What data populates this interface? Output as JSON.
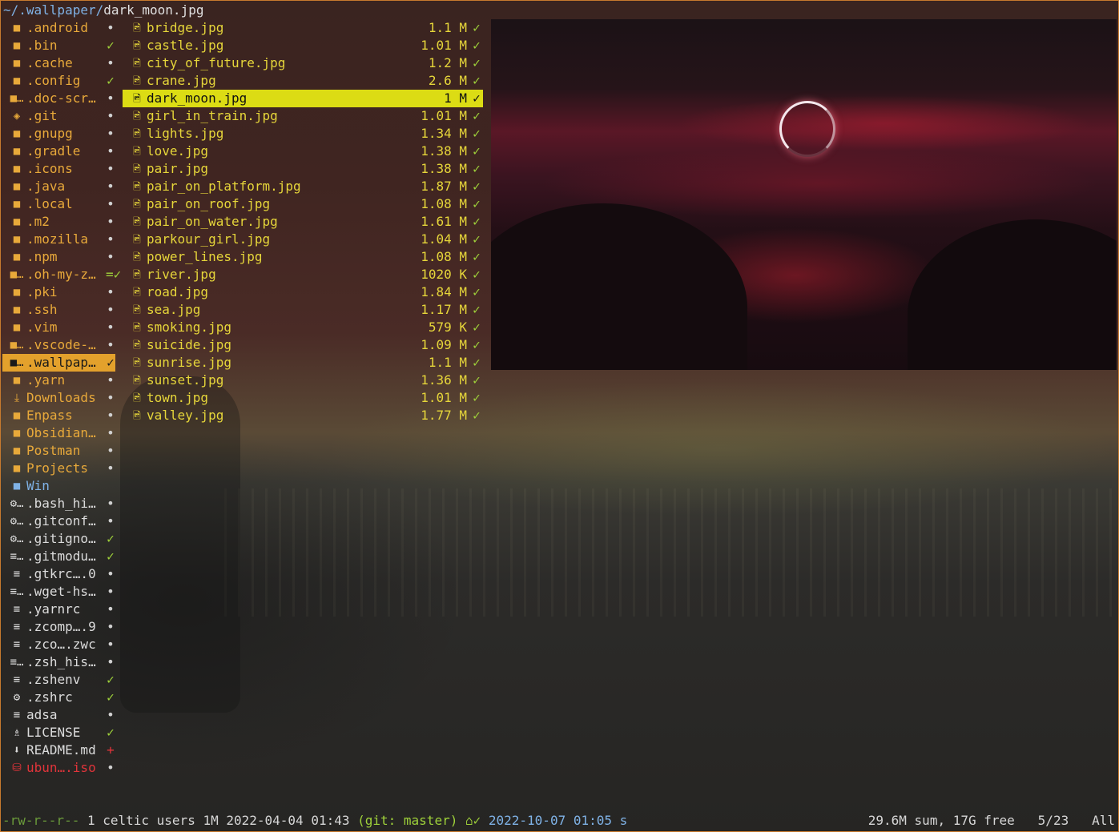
{
  "header": {
    "dir": "~/.wallpaper/",
    "file": "dark_moon.jpg"
  },
  "parent": [
    {
      "icon": "folder-icon",
      "glyph": "■",
      "name": ".android",
      "git": "•",
      "cls": "dirc"
    },
    {
      "icon": "folder-icon",
      "glyph": "■",
      "name": ".bin",
      "git": "✓",
      "cls": "dirc"
    },
    {
      "icon": "folder-icon",
      "glyph": "■",
      "name": ".cache",
      "git": "•",
      "cls": "dirc"
    },
    {
      "icon": "folder-icon",
      "glyph": "■",
      "name": ".config",
      "git": "✓",
      "cls": "dirc"
    },
    {
      "icon": "folder-icon",
      "glyph": "■…",
      "name": ".doc-scr…",
      "git": "•",
      "cls": "dirc"
    },
    {
      "icon": "git-icon",
      "glyph": "◈",
      "name": ".git",
      "git": "•",
      "cls": "dirc"
    },
    {
      "icon": "folder-icon",
      "glyph": "■",
      "name": ".gnupg",
      "git": "•",
      "cls": "dirc"
    },
    {
      "icon": "folder-icon",
      "glyph": "■",
      "name": ".gradle",
      "git": "•",
      "cls": "dirc"
    },
    {
      "icon": "folder-icon",
      "glyph": "■",
      "name": ".icons",
      "git": "•",
      "cls": "dirc"
    },
    {
      "icon": "folder-icon",
      "glyph": "■",
      "name": ".java",
      "git": "•",
      "cls": "dirc"
    },
    {
      "icon": "folder-icon",
      "glyph": "■",
      "name": ".local",
      "git": "•",
      "cls": "dirc"
    },
    {
      "icon": "folder-icon",
      "glyph": "■",
      "name": ".m2",
      "git": "•",
      "cls": "dirc"
    },
    {
      "icon": "folder-icon",
      "glyph": "■",
      "name": ".mozilla",
      "git": "•",
      "cls": "dirc"
    },
    {
      "icon": "folder-icon",
      "glyph": "■",
      "name": ".npm",
      "git": "•",
      "cls": "dirc"
    },
    {
      "icon": "folder-icon",
      "glyph": "■…",
      "name": ".oh-my-z…",
      "git": "=✓",
      "cls": "dirc"
    },
    {
      "icon": "folder-icon",
      "glyph": "■",
      "name": ".pki",
      "git": "•",
      "cls": "dirc"
    },
    {
      "icon": "folder-icon",
      "glyph": "■",
      "name": ".ssh",
      "git": "•",
      "cls": "dirc"
    },
    {
      "icon": "folder-icon",
      "glyph": "■",
      "name": ".vim",
      "git": "•",
      "cls": "dirc"
    },
    {
      "icon": "folder-icon",
      "glyph": "■…",
      "name": ".vscode-…",
      "git": "•",
      "cls": "dirc"
    },
    {
      "icon": "folder-icon",
      "glyph": "■…",
      "name": ".wallpap…",
      "git": "✓",
      "cls": "dirc",
      "selected": true
    },
    {
      "icon": "folder-icon",
      "glyph": "■",
      "name": ".yarn",
      "git": "•",
      "cls": "dirc"
    },
    {
      "icon": "downloads-icon",
      "glyph": "⤓",
      "name": "Downloads",
      "git": "•",
      "cls": "dirc"
    },
    {
      "icon": "folder-icon",
      "glyph": "■",
      "name": "Enpass",
      "git": "•",
      "cls": "dirc"
    },
    {
      "icon": "folder-icon",
      "glyph": "■",
      "name": "Obsidian…",
      "git": "•",
      "cls": "dirc"
    },
    {
      "icon": "folder-icon",
      "glyph": "■",
      "name": "Postman",
      "git": "•",
      "cls": "dirc"
    },
    {
      "icon": "folder-icon",
      "glyph": "■",
      "name": "Projects",
      "git": "•",
      "cls": "dirc"
    },
    {
      "icon": "folder-icon",
      "glyph": "■",
      "name": "Win",
      "git": "",
      "cls": "winc"
    },
    {
      "icon": "config-file-icon",
      "glyph": "⚙…",
      "name": ".bash_hi…",
      "git": "•",
      "cls": "filec"
    },
    {
      "icon": "config-file-icon",
      "glyph": "⚙…",
      "name": ".gitconf…",
      "git": "•",
      "cls": "filec"
    },
    {
      "icon": "config-file-icon",
      "glyph": "⚙…",
      "name": ".gitigno…",
      "git": "✓",
      "cls": "filec"
    },
    {
      "icon": "text-file-icon",
      "glyph": "≡…",
      "name": ".gitmodu…",
      "git": "✓",
      "cls": "filec"
    },
    {
      "icon": "text-file-icon",
      "glyph": "≡",
      "name": ".gtkrc….0",
      "git": "•",
      "cls": "filec"
    },
    {
      "icon": "text-file-icon",
      "glyph": "≡…",
      "name": ".wget-hs…",
      "git": "•",
      "cls": "filec"
    },
    {
      "icon": "text-file-icon",
      "glyph": "≡",
      "name": ".yarnrc",
      "git": "•",
      "cls": "filec"
    },
    {
      "icon": "text-file-icon",
      "glyph": "≡",
      "name": ".zcomp….9",
      "git": "•",
      "cls": "filec"
    },
    {
      "icon": "text-file-icon",
      "glyph": "≡",
      "name": ".zco….zwc",
      "git": "•",
      "cls": "filec"
    },
    {
      "icon": "text-file-icon",
      "glyph": "≡…",
      "name": ".zsh_his…",
      "git": "•",
      "cls": "filec"
    },
    {
      "icon": "text-file-icon",
      "glyph": "≡",
      "name": ".zshenv",
      "git": "✓",
      "cls": "filec"
    },
    {
      "icon": "gear-icon",
      "glyph": "⚙",
      "name": ".zshrc",
      "git": "✓",
      "cls": "filec"
    },
    {
      "icon": "text-file-icon",
      "glyph": "≡",
      "name": "adsa",
      "git": "•",
      "cls": "filec"
    },
    {
      "icon": "license-icon",
      "glyph": "♗",
      "name": "LICENSE",
      "git": "✓",
      "cls": "filec"
    },
    {
      "icon": "markdown-icon",
      "glyph": "⬇",
      "name": "README.md",
      "git": "+",
      "cls": "filec"
    },
    {
      "icon": "disk-image-icon",
      "glyph": "⛁",
      "name": "ubun….iso",
      "git": "•",
      "cls": "redc"
    }
  ],
  "files": [
    {
      "name": "bridge.jpg",
      "size": "1.1 M",
      "git": "✓"
    },
    {
      "name": "castle.jpg",
      "size": "1.01 M",
      "git": "✓"
    },
    {
      "name": "city_of_future.jpg",
      "size": "1.2 M",
      "git": "✓"
    },
    {
      "name": "crane.jpg",
      "size": "2.6 M",
      "git": "✓"
    },
    {
      "name": "dark_moon.jpg",
      "size": "1 M",
      "git": "✓",
      "selected": true
    },
    {
      "name": "girl_in_train.jpg",
      "size": "1.01 M",
      "git": "✓"
    },
    {
      "name": "lights.jpg",
      "size": "1.34 M",
      "git": "✓"
    },
    {
      "name": "love.jpg",
      "size": "1.38 M",
      "git": "✓"
    },
    {
      "name": "pair.jpg",
      "size": "1.38 M",
      "git": "✓"
    },
    {
      "name": "pair_on_platform.jpg",
      "size": "1.87 M",
      "git": "✓"
    },
    {
      "name": "pair_on_roof.jpg",
      "size": "1.08 M",
      "git": "✓"
    },
    {
      "name": "pair_on_water.jpg",
      "size": "1.61 M",
      "git": "✓"
    },
    {
      "name": "parkour_girl.jpg",
      "size": "1.04 M",
      "git": "✓"
    },
    {
      "name": "power_lines.jpg",
      "size": "1.08 M",
      "git": "✓"
    },
    {
      "name": "river.jpg",
      "size": "1020 K",
      "git": "✓"
    },
    {
      "name": "road.jpg",
      "size": "1.84 M",
      "git": "✓"
    },
    {
      "name": "sea.jpg",
      "size": "1.17 M",
      "git": "✓"
    },
    {
      "name": "smoking.jpg",
      "size": "579 K",
      "git": "✓"
    },
    {
      "name": "suicide.jpg",
      "size": "1.09 M",
      "git": "✓"
    },
    {
      "name": "sunrise.jpg",
      "size": "1.1 M",
      "git": "✓"
    },
    {
      "name": "sunset.jpg",
      "size": "1.36 M",
      "git": "✓"
    },
    {
      "name": "town.jpg",
      "size": "1.01 M",
      "git": "✓"
    },
    {
      "name": "valley.jpg",
      "size": "1.77 M",
      "git": "✓"
    }
  ],
  "status": {
    "perm": "-rw-r--r--",
    "info": " 1 celtic users 1M 2022-04-04 01:43 ",
    "git": "(git: master) ⌂✓ ",
    "date": "2022-10-07 01:05 s",
    "right": "29.6M sum, 17G free   5/23   All"
  }
}
